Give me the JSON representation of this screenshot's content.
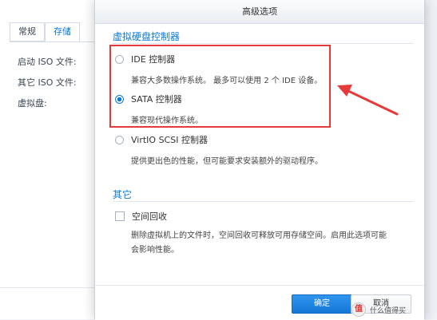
{
  "background": {
    "tabs": [
      {
        "label": "常规"
      },
      {
        "label": "存储"
      }
    ],
    "labels": {
      "boot_iso": "启动 ISO 文件:",
      "other_iso": "其它 ISO 文件:",
      "virtual_disk": "虚拟盘:"
    }
  },
  "dialog": {
    "title": "高级选项",
    "controller_section": {
      "title": "虚拟硬盘控制器",
      "options": [
        {
          "label": "IDE 控制器",
          "description": "兼容大多数操作系统。 最多可以使用 2 个 IDE 设备。",
          "selected": false
        },
        {
          "label": "SATA 控制器",
          "description": "兼容现代操作系统。",
          "selected": true
        },
        {
          "label": "VirtIO SCSI 控制器",
          "description": "提供更出色的性能，但可能要求安装额外的驱动程序。",
          "selected": false
        }
      ]
    },
    "other_section": {
      "title": "其它",
      "space_reclaim": {
        "label": "空间回收",
        "checked": false,
        "description": "删除虚拟机上的文件时，空间回收可释放可用存储空间。启用此选项可能会影响性能。"
      }
    },
    "buttons": {
      "ok": "确定",
      "cancel": "取消"
    }
  },
  "watermark": {
    "text": "值 什么值得买"
  },
  "colors": {
    "accent": "#0a79d9",
    "annotation_red": "#e43a3a"
  }
}
